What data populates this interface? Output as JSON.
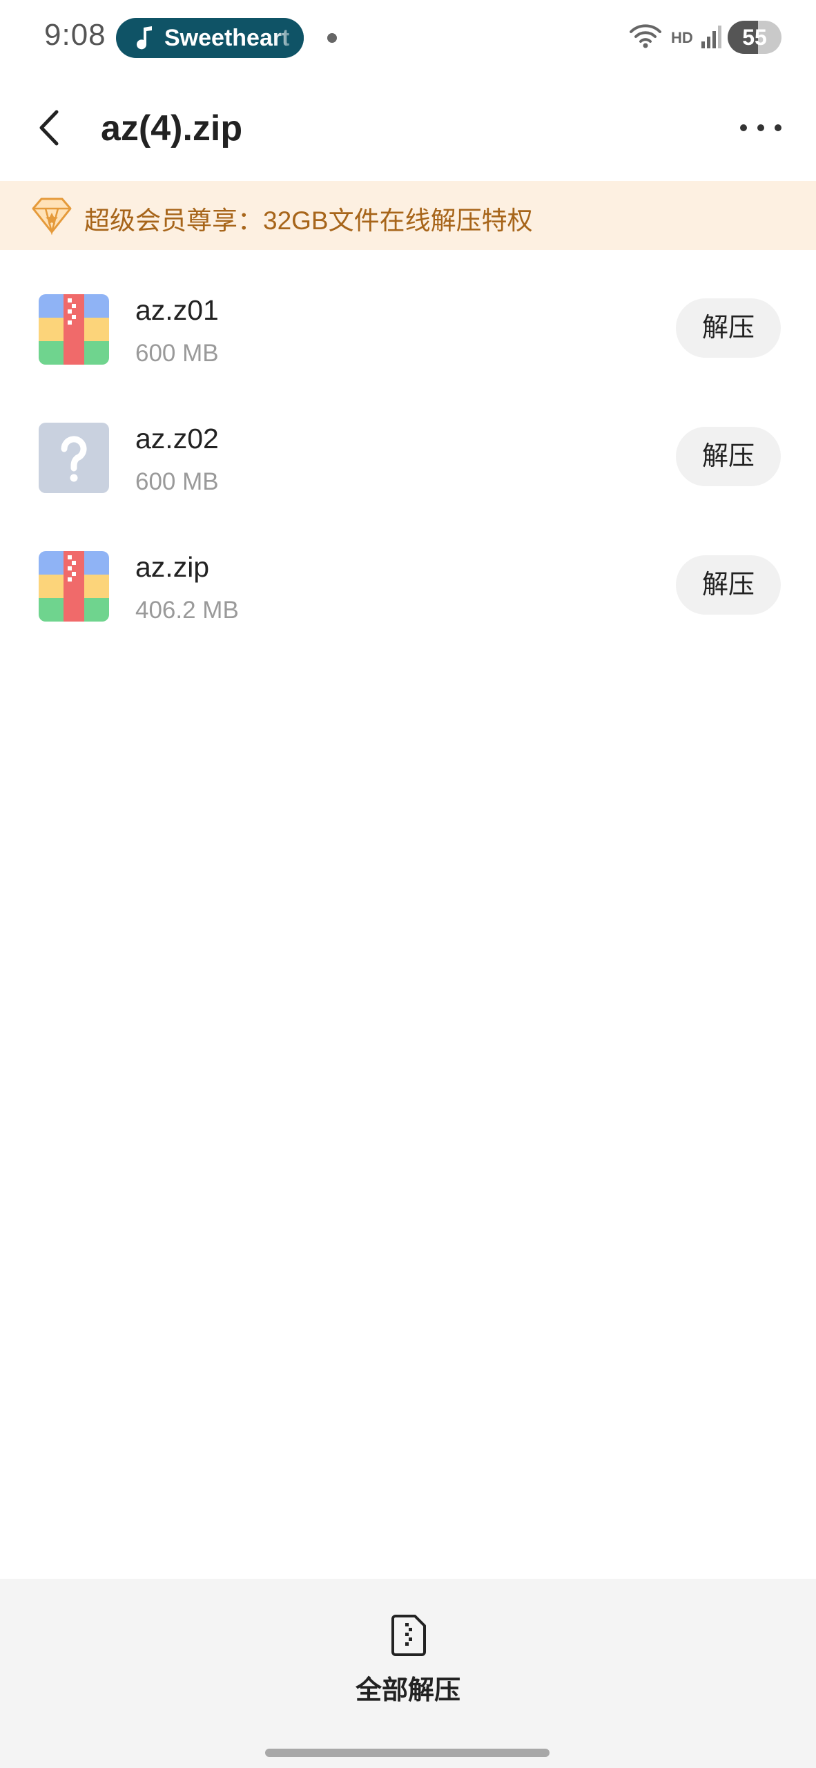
{
  "status_bar": {
    "time": "9:08",
    "media_pill_text": "Sweetheart",
    "network_label": "HD",
    "battery_level": "55"
  },
  "app_bar": {
    "title": "az(4).zip"
  },
  "banner": {
    "text": "超级会员尊享：32GB文件在线解压特权"
  },
  "files": [
    {
      "name": "az.z01",
      "size": "600 MB",
      "icon": "zip-archive-icon",
      "action": "解压"
    },
    {
      "name": "az.z02",
      "size": "600 MB",
      "icon": "unknown-file-icon",
      "action": "解压"
    },
    {
      "name": "az.zip",
      "size": "406.2 MB",
      "icon": "zip-archive-icon",
      "action": "解压"
    }
  ],
  "bottom_bar": {
    "extract_all_label": "全部解压"
  },
  "colors": {
    "banner_bg": "#fdf0e1",
    "banner_text": "#a7651a",
    "media_pill": "#0f5366",
    "button_bg": "#f1f1f1"
  }
}
